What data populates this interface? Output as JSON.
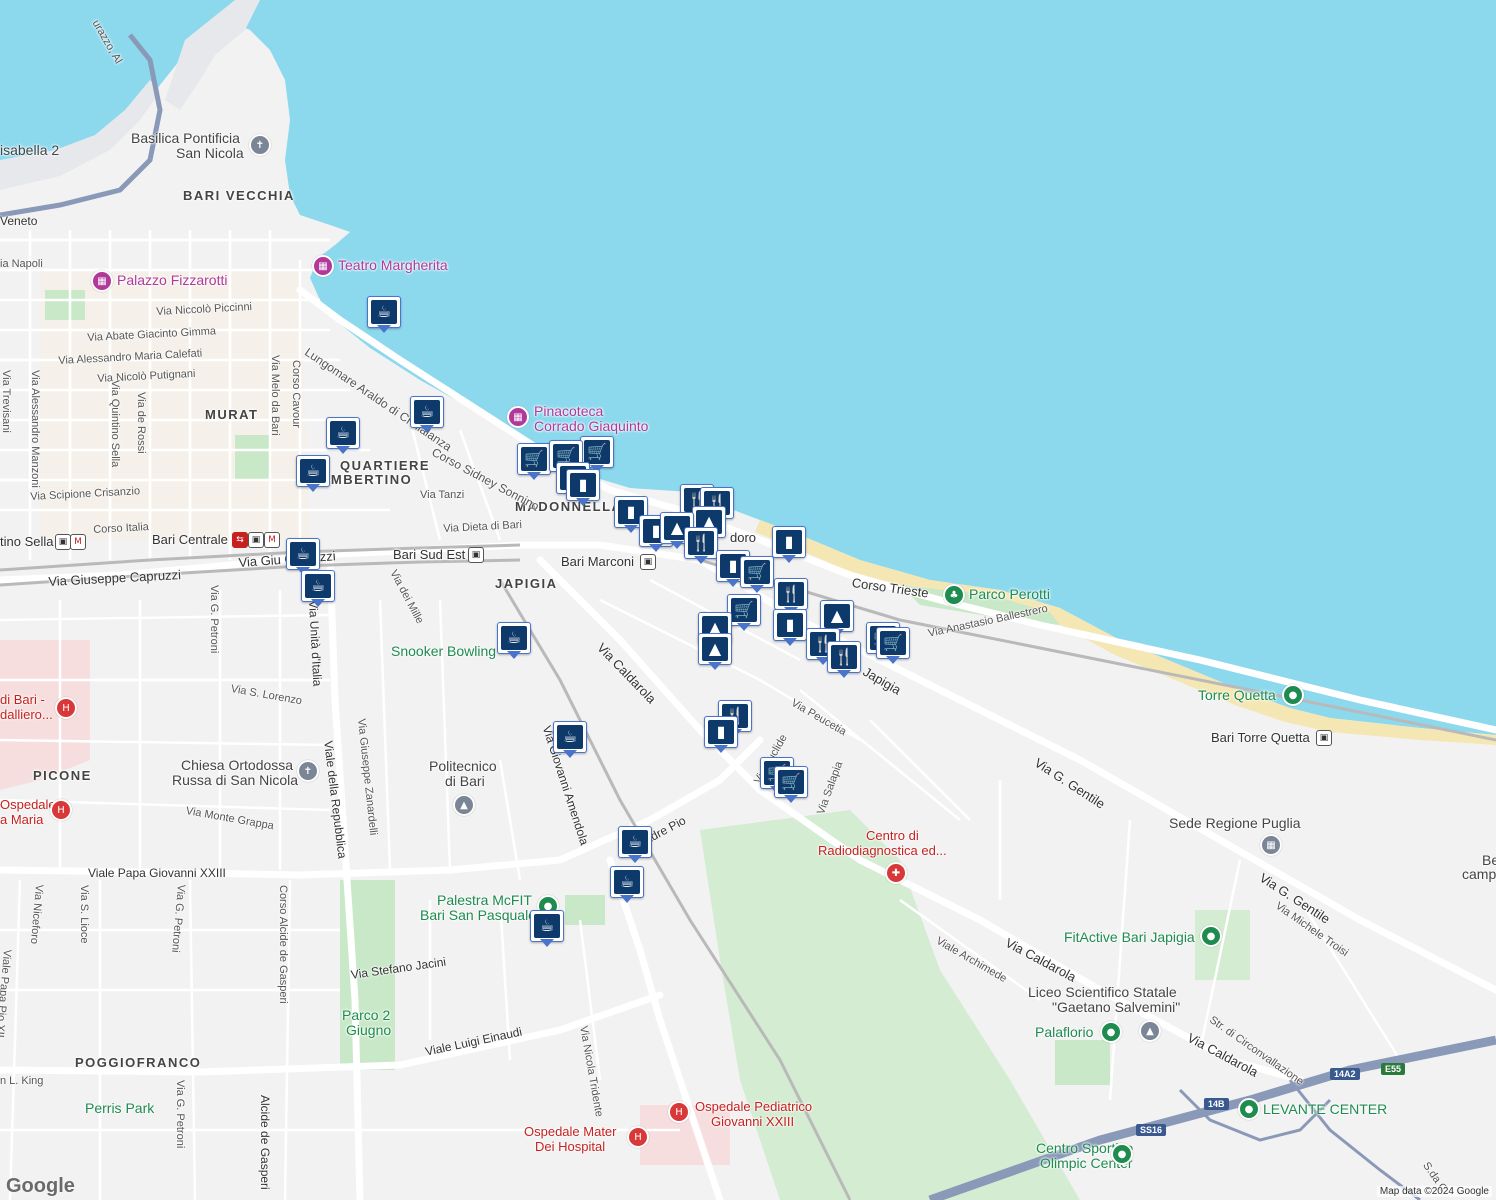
{
  "map": {
    "colors": {
      "sea": "#8cd9ee",
      "land": "#f2f2f3",
      "park": "#c9e8c8",
      "road_major": "#ffffff",
      "highway": "#8a99b8",
      "rail": "#b9b9b9",
      "marker_dark": "#0e3a6b",
      "marker_border": "#4a74c9"
    },
    "districts": [
      "BARI VECCHIA",
      "MURAT",
      "QUARTIERE",
      "UMBERTINO",
      "MADONNELLA",
      "JAPIGIA",
      "PICONE",
      "POGGIOFRANCO"
    ],
    "pois": {
      "basilica": [
        "Basilica Pontificia",
        "San Nicola"
      ],
      "teatro": "Teatro Margherita",
      "palazzo": "Palazzo Fizzarotti",
      "pinacoteca": [
        "Pinacoteca",
        "Corrado Giaquinto"
      ],
      "parco_perotti": "Parco Perotti",
      "torre_quetta": "Torre Quetta",
      "snooker": "Snooker Bowling",
      "chiesa": [
        "Chiesa Ortodossa",
        "Russa di San Nicola"
      ],
      "politecnico": [
        "Politecnico",
        "di Bari"
      ],
      "palestra": [
        "Palestra McFIT",
        "Bari San Pasquale"
      ],
      "parco2giugno": [
        "Parco 2",
        "Giugno"
      ],
      "perris": "Perris Park",
      "radiodiagnostica": [
        "Centro di",
        "Radiodiagnostica ed..."
      ],
      "sede_regione": "Sede Regione Puglia",
      "fitactive": "FitActive Bari Japigia",
      "liceo": [
        "Liceo Scientifico Statale",
        "\"Gaetano Salvemini\""
      ],
      "palaflorio": "Palaflorio",
      "levante": "LEVANTE CENTER",
      "olimpic": [
        "Centro Sportivo",
        "Olimpic Center"
      ],
      "pediatrico": [
        "Ospedale Pediatrico",
        "Giovanni XXIII"
      ],
      "mater_dei": [
        "Ospedale Mater",
        "Dei Hospital"
      ],
      "osp_bari": [
        "di Bari -",
        "dalliero..."
      ],
      "osp_maria": [
        "Ospedale",
        "a Maria"
      ],
      "isabella": "isabella 2",
      "campo": [
        "Be",
        "campo scu"
      ]
    },
    "stations": {
      "centrale": "Bari Centrale",
      "sud_est": "Bari Sud Est",
      "marconi": "Bari Marconi",
      "torre_quetta": "Bari Torre Quetta",
      "sella": "tino Sella",
      "perotti_partial": "doro"
    },
    "streets": {
      "lungomare": "Lungomare Araldo di Crollalanza",
      "sonnino": "Corso Sidney Sonnino",
      "trieste": "Corso Trieste",
      "ballestrero": "Via Anastasio Ballestrero",
      "gentile1": "Via G. Gentile",
      "gentile2": "Via G. Gentile",
      "caldarola1": "Via Caldarola",
      "caldarola2": "Via Caldarola",
      "caldarola3": "Via Caldarola",
      "capruzzi": "Via Giuseppe Capruzzi",
      "capruzzi2": "Via Giu    Capruzzi",
      "corso_italia": "Corso Italia",
      "dieta": "Via Dieta di Bari",
      "tanzi": "Via Tanzi",
      "crisanzio": "Via Scipione Crisanzio",
      "piccinni": "Via Niccolò Piccinni",
      "gimma": "Via Abate Giacinto Gimma",
      "calefati": "Via Alessandro Maria Calefati",
      "putignani": "Via Nicolò Putignani",
      "cavour": "Corso Cavour",
      "melo": "Via Melo da Bari",
      "trevisani": "Via Trevisani",
      "manzoni": "Via Alessandro Manzoni",
      "sella": "Via Quintino Sella",
      "rossi": "Via de Rossi",
      "napoli": "ia Napoli",
      "veneto": "Veneto",
      "mille": "Via dei Mille",
      "unita": "Via Unità d'Italia",
      "repubblica": "Viale della Repubblica",
      "zanardelli": "Via Giuseppe Zanardelli",
      "lorenzo": "Via S. Lorenzo",
      "grappa": "Via Monte Grappa",
      "petroni1": "Via G. Petroni",
      "petroni2": "Via G. Petroni",
      "petroni3": "Via G. Petroni",
      "amendola": "Via Giovanni Amendola",
      "padre_pio": "Padre Pio",
      "papa": "Viale Papa Giovanni XXIII",
      "niceforo": "Via Niceforo",
      "lioce": "Via S. Lioce",
      "papa_pio": "Viale Papa Pio XII",
      "gasperi1": "Corso Alcide de Gasperi",
      "gasperi2": "Alcide de Gasperi",
      "jacini": "Via Stefano Jacini",
      "einaudi": "Viale Luigi Einaudi",
      "tridente": "Via Nicola Tridente",
      "king": "n L. King",
      "peucetia": "Via Peucetia",
      "salapia": "Via Salapia",
      "euclide": "Via Euclide",
      "japigia_st": "Japigia",
      "archimede": "Viale Archimede",
      "troisi": "Via Michele Troisi",
      "circonvallazione": "Str. di Circonvallazione",
      "sda": "S.da C",
      "durazzo": "urazzo, Al"
    },
    "shields": [
      "14A2",
      "E55",
      "14B",
      "SS16"
    ],
    "attribution": "Map data ©2024 Google",
    "logo": "Google",
    "marker_icons": [
      "cup-icon",
      "cart-icon",
      "bag-icon",
      "fork-knife-icon",
      "school-icon"
    ]
  }
}
